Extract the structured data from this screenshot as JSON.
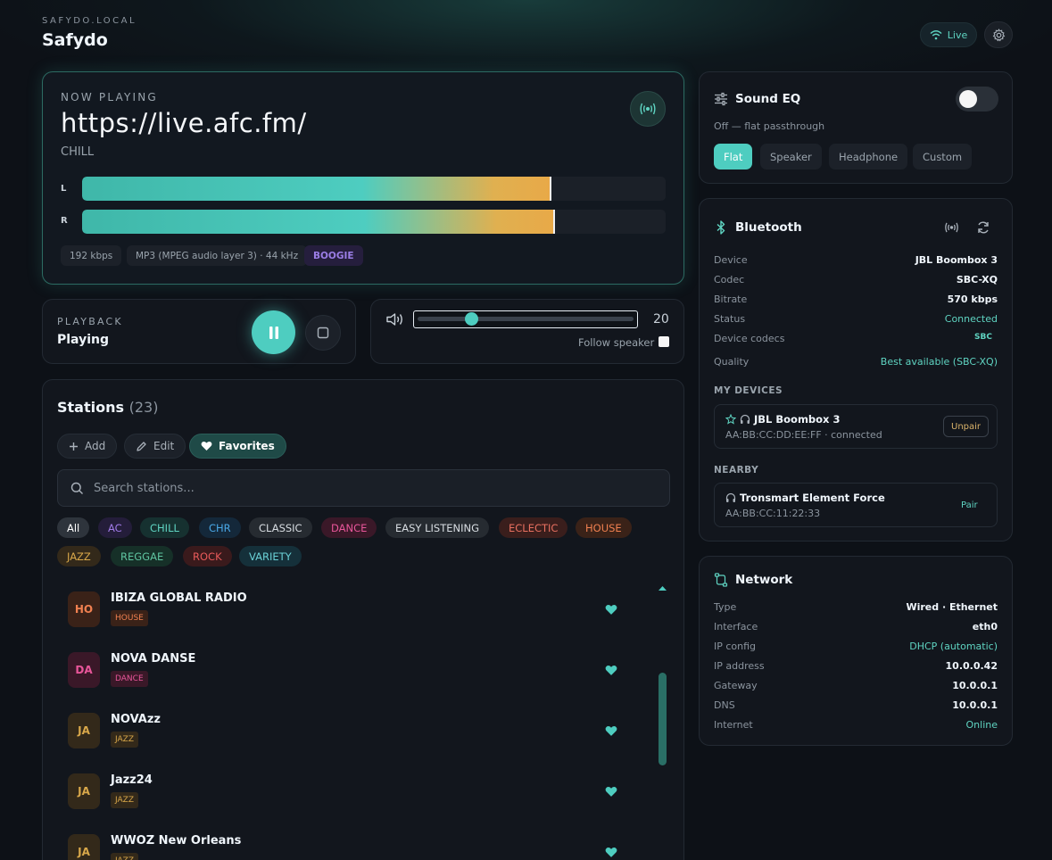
{
  "header": {
    "host": "SAFYDO.LOCAL",
    "app_title": "Safydo",
    "live_label": "Live"
  },
  "now_playing": {
    "label": "NOW PLAYING",
    "title": "https://live.afc.fm/",
    "genre": "CHILL",
    "meter_left_label": "L",
    "meter_right_label": "R",
    "meter_left_level": 0.801,
    "meter_right_level": 0.808,
    "bitrate": "192 kbps",
    "codec": "MP3 (MPEG audio layer 3) · 44 kHz",
    "tag": "BOOGIE"
  },
  "playback": {
    "label": "PLAYBACK",
    "state": "Playing"
  },
  "volume": {
    "value": "20",
    "level": 0.23,
    "follow_label": "Follow speaker"
  },
  "stations": {
    "title": "Stations",
    "count": "(23)",
    "add_label": "Add",
    "edit_label": "Edit",
    "favorites_label": "Favorites",
    "search_placeholder": "Search stations...",
    "genres": [
      {
        "label": "All",
        "fg": "#ffffff",
        "bg": "#2e343c"
      },
      {
        "label": "AC",
        "fg": "#a17be8",
        "bg": "#241d3a"
      },
      {
        "label": "CHILL",
        "fg": "#5fd4c2",
        "bg": "#163130"
      },
      {
        "label": "CHR",
        "fg": "#4aa9e8",
        "bg": "#14283a"
      },
      {
        "label": "CLASSIC",
        "fg": "#d8dde2",
        "bg": "#262b31"
      },
      {
        "label": "DANCE",
        "fg": "#e8569a",
        "bg": "#3a1828"
      },
      {
        "label": "EASY LISTENING",
        "fg": "#d8dde2",
        "bg": "#262b31"
      },
      {
        "label": "ECLECTIC",
        "fg": "#e87060",
        "bg": "#3a1e1c"
      },
      {
        "label": "HOUSE",
        "fg": "#f08050",
        "bg": "#3a2218"
      },
      {
        "label": "JAZZ",
        "fg": "#d9a84a",
        "bg": "#33291a"
      },
      {
        "label": "REGGAE",
        "fg": "#5fc4a0",
        "bg": "#163028"
      },
      {
        "label": "ROCK",
        "fg": "#e85a5a",
        "bg": "#3a1a1c"
      },
      {
        "label": "VARIETY",
        "fg": "#6ad0d6",
        "bg": "#15303a"
      }
    ],
    "rows": [
      {
        "initials": "HO",
        "name": "IBIZA GLOBAL RADIO",
        "tag": "HOUSE",
        "fg": "#f08050",
        "bg": "#3a2218"
      },
      {
        "initials": "DA",
        "name": "NOVA DANSE",
        "tag": "DANCE",
        "fg": "#e8569a",
        "bg": "#3a1828"
      },
      {
        "initials": "JA",
        "name": "NOVAzz",
        "tag": "JAZZ",
        "fg": "#d9a84a",
        "bg": "#33291a"
      },
      {
        "initials": "JA",
        "name": "Jazz24",
        "tag": "JAZZ",
        "fg": "#d9a84a",
        "bg": "#33291a"
      },
      {
        "initials": "JA",
        "name": "WWOZ New Orleans",
        "tag": "JAZZ",
        "fg": "#d9a84a",
        "bg": "#33291a"
      }
    ]
  },
  "eq": {
    "title": "Sound EQ",
    "desc": "Off — flat passthrough",
    "presets": [
      "Flat",
      "Speaker",
      "Headphone",
      "Custom"
    ]
  },
  "bluetooth": {
    "title": "Bluetooth",
    "fields": [
      {
        "k": "Device",
        "v": "JBL Boombox 3",
        "color": "#f0f6fc"
      },
      {
        "k": "Codec",
        "v": "SBC-XQ",
        "color": "#f0f6fc"
      },
      {
        "k": "Bitrate",
        "v": "570 kbps",
        "color": "#f0f6fc"
      },
      {
        "k": "Status",
        "v": "Connected",
        "color": "#5fd4c2"
      },
      {
        "k": "Device codecs",
        "v": "SBC",
        "color": "#5fd4c2"
      },
      {
        "k": "Quality",
        "v": "Best available (SBC-XQ)",
        "color": "#5fd4c2"
      }
    ],
    "my_devices_label": "MY DEVICES",
    "my_device": {
      "name": "JBL Boombox 3",
      "mac": "AA:BB:CC:DD:EE:FF · connected",
      "action": "Unpair"
    },
    "nearby_label": "NEARBY",
    "nearby_device": {
      "name": "Tronsmart Element Force",
      "mac": "AA:BB:CC:11:22:33",
      "action": "Pair"
    }
  },
  "network": {
    "title": "Network",
    "fields": [
      {
        "k": "Type",
        "v": "Wired · Ethernet",
        "color": "#f0f6fc"
      },
      {
        "k": "Interface",
        "v": "eth0",
        "color": "#f0f6fc"
      },
      {
        "k": "IP config",
        "v": "DHCP (automatic)",
        "color": "#5fd4c2"
      },
      {
        "k": "IP address",
        "v": "10.0.0.42",
        "color": "#f0f6fc"
      },
      {
        "k": "Gateway",
        "v": "10.0.0.1",
        "color": "#f0f6fc"
      },
      {
        "k": "DNS",
        "v": "10.0.0.1",
        "color": "#f0f6fc"
      },
      {
        "k": "Internet",
        "v": "Online",
        "color": "#5fd4c2"
      }
    ]
  },
  "colors": {
    "accent": "#4ecdc0",
    "background": "#0d1117",
    "card": "#12161d"
  }
}
